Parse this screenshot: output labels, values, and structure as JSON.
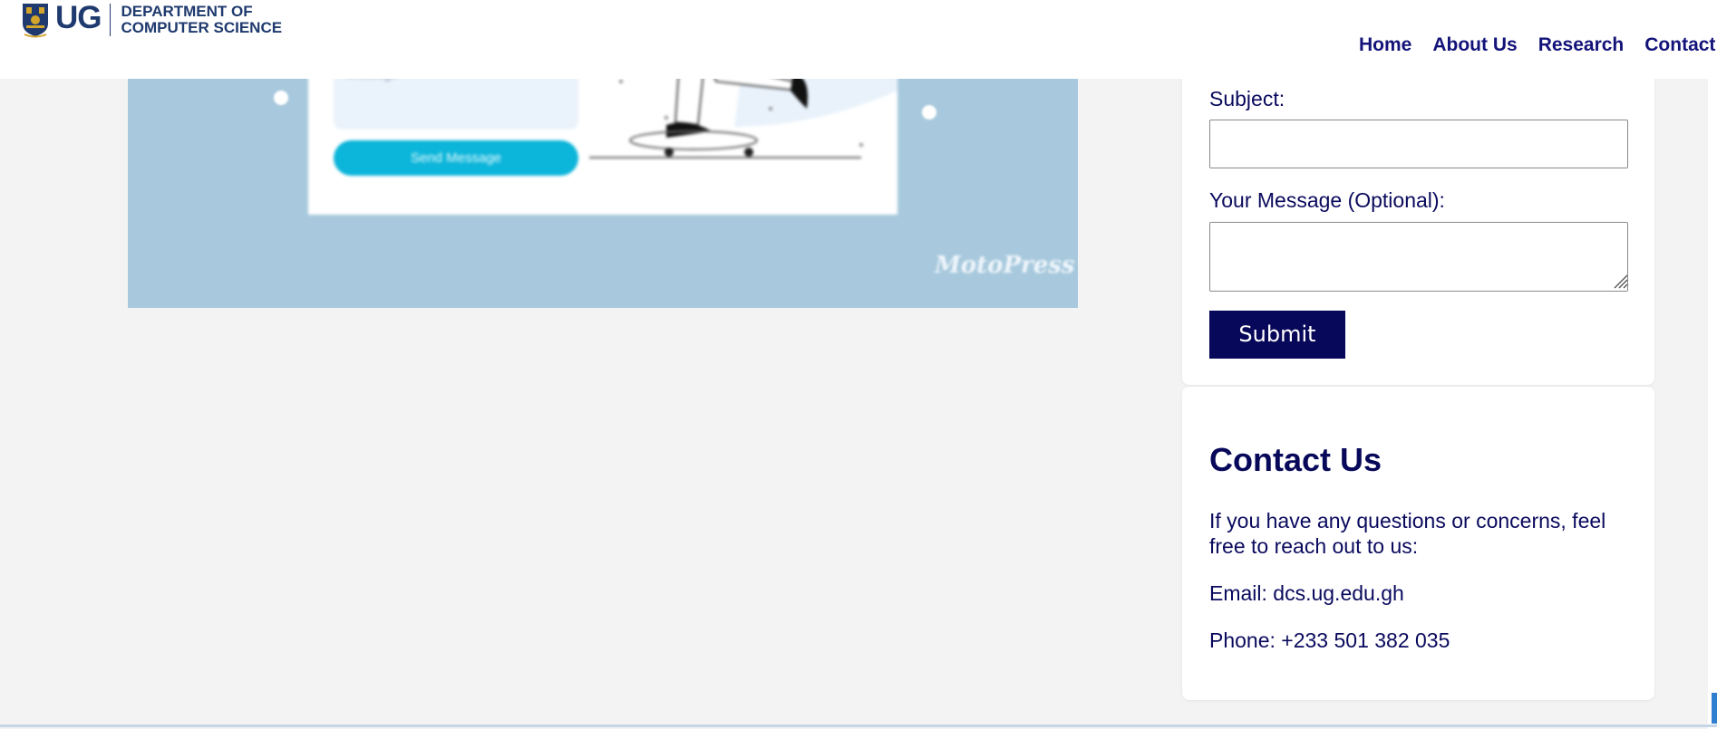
{
  "header": {
    "logo_text": "UG",
    "dept_line1": "DEPARTMENT OF",
    "dept_line2": "COMPUTER SCIENCE",
    "nav": [
      {
        "label": "Home"
      },
      {
        "label": "About Us"
      },
      {
        "label": "Research"
      },
      {
        "label": "Contact"
      }
    ]
  },
  "illustration": {
    "field_placeholder": "Message",
    "button_label": "Send Message",
    "signature": "MotoPress"
  },
  "form": {
    "subject_label": "Subject:",
    "subject_value": "",
    "message_label": "Your Message (Optional):",
    "message_value": "",
    "submit_label": "Submit"
  },
  "contact": {
    "title": "Contact Us",
    "intro": "If you have any questions or concerns, feel free to reach out to us:",
    "email": "Email: dcs.ug.edu.gh",
    "phone": "Phone: +233 501 382 035"
  },
  "colors": {
    "brand_navy": "#08085a",
    "illustration_bg": "#a8c9dd",
    "page_bg": "#f3f3f3"
  }
}
